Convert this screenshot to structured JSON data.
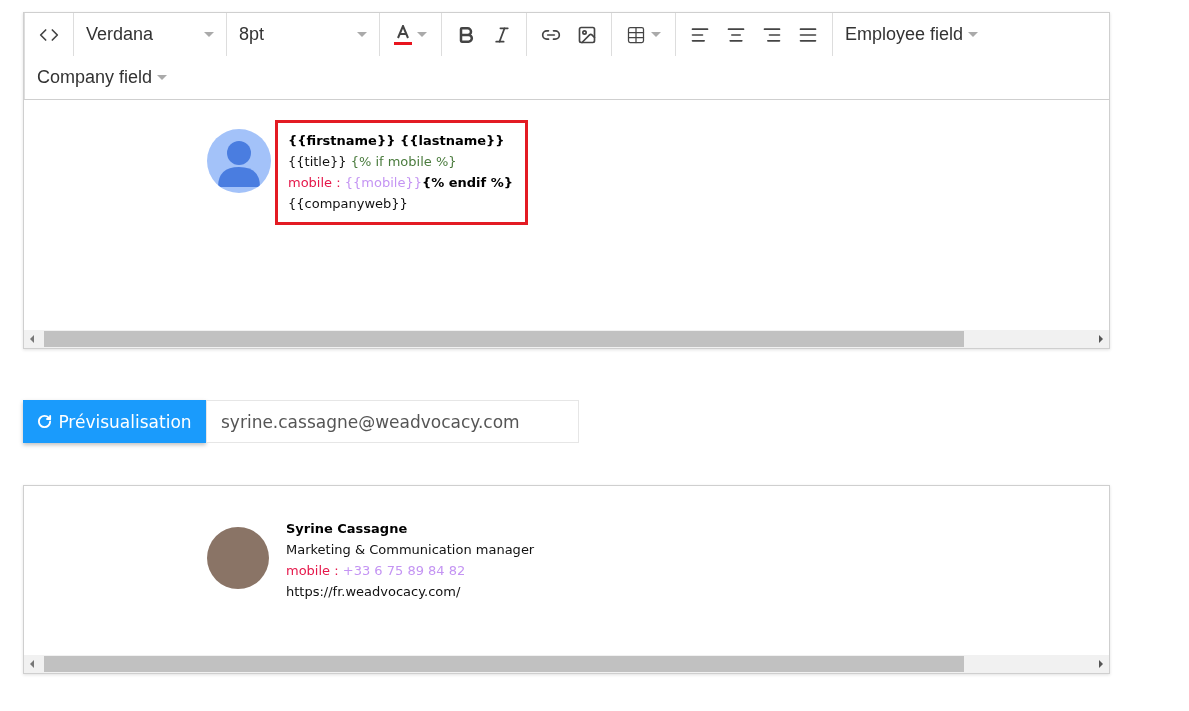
{
  "toolbar": {
    "font": "Verdana",
    "size": "8pt",
    "dropdowns": [
      "Employee field",
      "Company field"
    ]
  },
  "editor": {
    "signature": {
      "selected": true,
      "lines": [
        [
          {
            "text": "{{firstname}} {{lastname}}",
            "kind": "bold"
          }
        ],
        [
          {
            "text": "{{title}}",
            "kind": "plain"
          },
          {
            "text": " {% if mobile %}",
            "kind": "logic"
          }
        ],
        [
          {
            "text": "mobile : ",
            "kind": "label"
          },
          {
            "text": "{{mobile}}",
            "kind": "value"
          },
          {
            "text": "{% endif %}",
            "kind": "bold"
          }
        ],
        [
          {
            "text": "{{companyweb}}",
            "kind": "plain"
          }
        ]
      ]
    }
  },
  "preview_bar": {
    "button": "Prévisualisation",
    "email": "syrine.cassagne@weadvocacy.com"
  },
  "preview": {
    "signature": {
      "lines": [
        [
          {
            "text": "Syrine Cassagne",
            "kind": "bold"
          }
        ],
        [
          {
            "text": "Marketing & Communication manager",
            "kind": "plain"
          }
        ],
        [
          {
            "text": "mobile : ",
            "kind": "label"
          },
          {
            "text": "+33 6 75 89 84 82",
            "kind": "value"
          }
        ],
        [
          {
            "text": "https://fr.weadvocacy.com/",
            "kind": "plain"
          }
        ]
      ]
    }
  }
}
